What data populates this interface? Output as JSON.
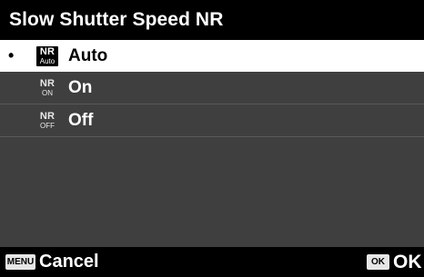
{
  "title": "Slow Shutter Speed NR",
  "menu": {
    "bullet": "•",
    "items": [
      {
        "icon": "nr-auto-icon",
        "icon_top": "NR",
        "icon_sub": "Auto",
        "label": "Auto",
        "selected": true
      },
      {
        "icon": "nr-on-icon",
        "icon_top": "NR",
        "icon_sub": "ON",
        "label": "On",
        "selected": false
      },
      {
        "icon": "nr-off-icon",
        "icon_top": "NR",
        "icon_sub": "OFF",
        "label": "Off",
        "selected": false
      }
    ]
  },
  "footer": {
    "menu_key": "MENU",
    "cancel_label": "Cancel",
    "ok_key": "OK",
    "ok_label": "OK"
  },
  "colors": {
    "background": "#3f3f3f",
    "bar": "#000000",
    "selected_row": "#ffffff",
    "disabled_text": "#8a8a8a"
  }
}
